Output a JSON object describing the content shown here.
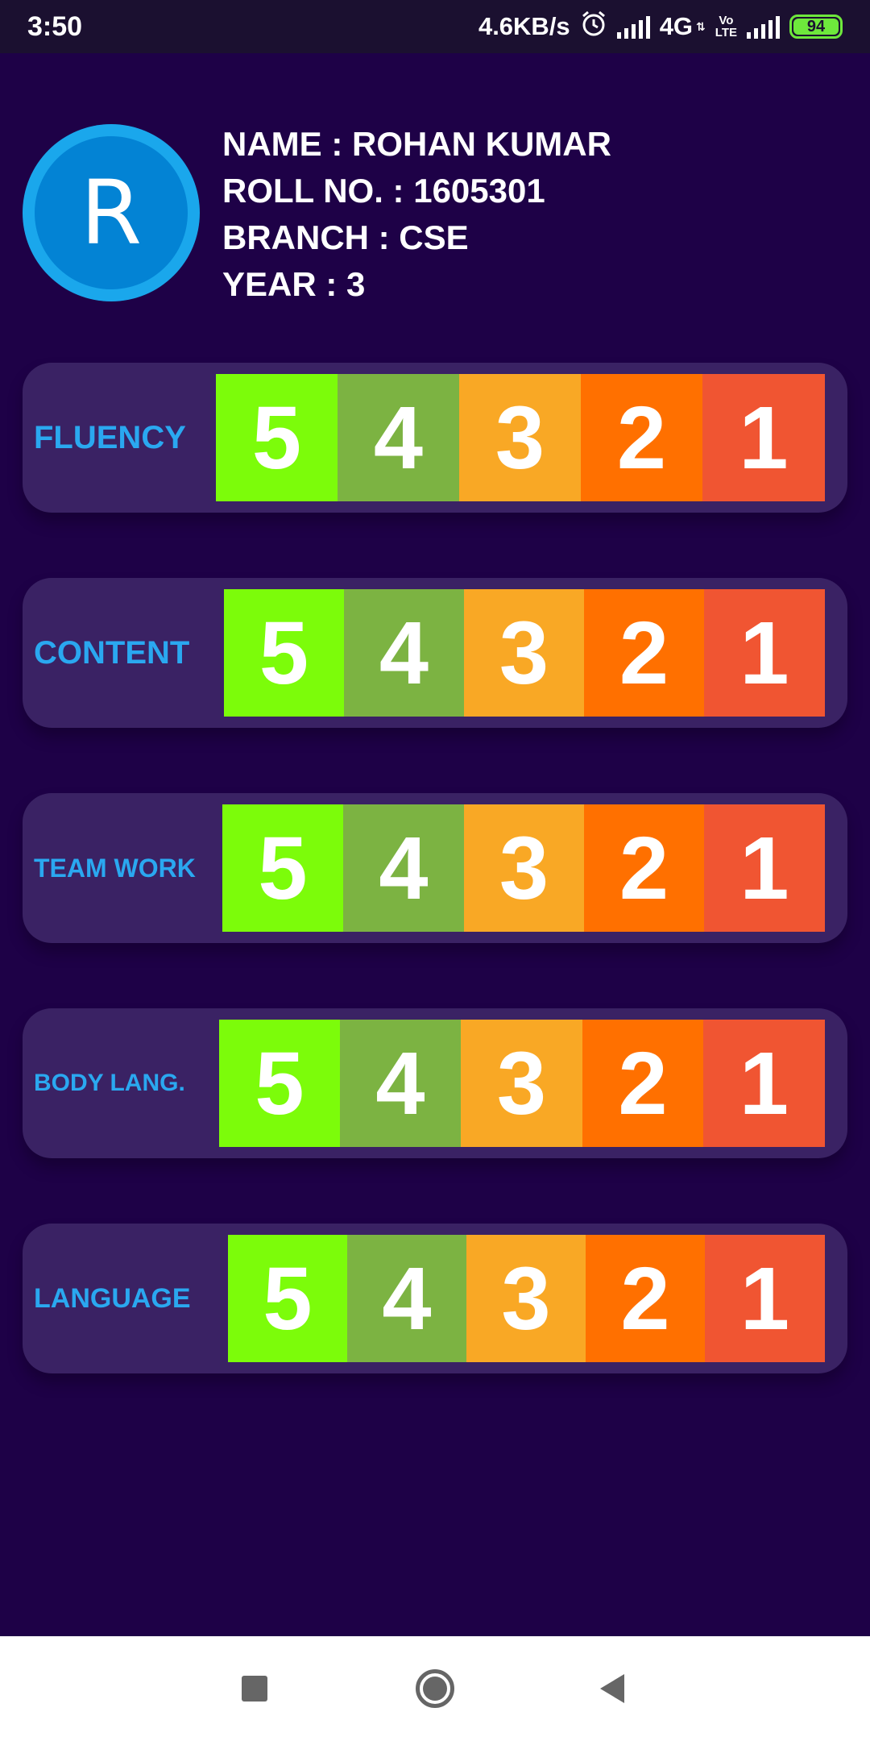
{
  "status_bar": {
    "time": "3:50",
    "speed": "4.6KB/s",
    "network": "4G",
    "volte_top": "Vo",
    "volte_bottom": "LTE",
    "battery": "94"
  },
  "profile": {
    "avatar_letter": "R",
    "name": "NAME : ROHAN KUMAR",
    "roll": "ROLL NO. : 1605301",
    "branch": "BRANCH : CSE",
    "year": "YEAR : 3"
  },
  "scale_colors": [
    "#7cfc0a",
    "#7cb342",
    "#f9a825",
    "#ff7000",
    "#f05532"
  ],
  "criteria": [
    {
      "label": "FLUENCY",
      "scores": [
        "5",
        "4",
        "3",
        "2",
        "1"
      ]
    },
    {
      "label": "CONTENT",
      "scores": [
        "5",
        "4",
        "3",
        "2",
        "1"
      ]
    },
    {
      "label": "TEAM WORK",
      "scores": [
        "5",
        "4",
        "3",
        "2",
        "1"
      ]
    },
    {
      "label": "BODY LANG.",
      "scores": [
        "5",
        "4",
        "3",
        "2",
        "1"
      ]
    },
    {
      "label": "LANGUAGE",
      "scores": [
        "5",
        "4",
        "3",
        "2",
        "1"
      ]
    }
  ],
  "nav": {
    "recents_icon": "square-icon",
    "home_icon": "circle-icon",
    "back_icon": "triangle-icon"
  }
}
